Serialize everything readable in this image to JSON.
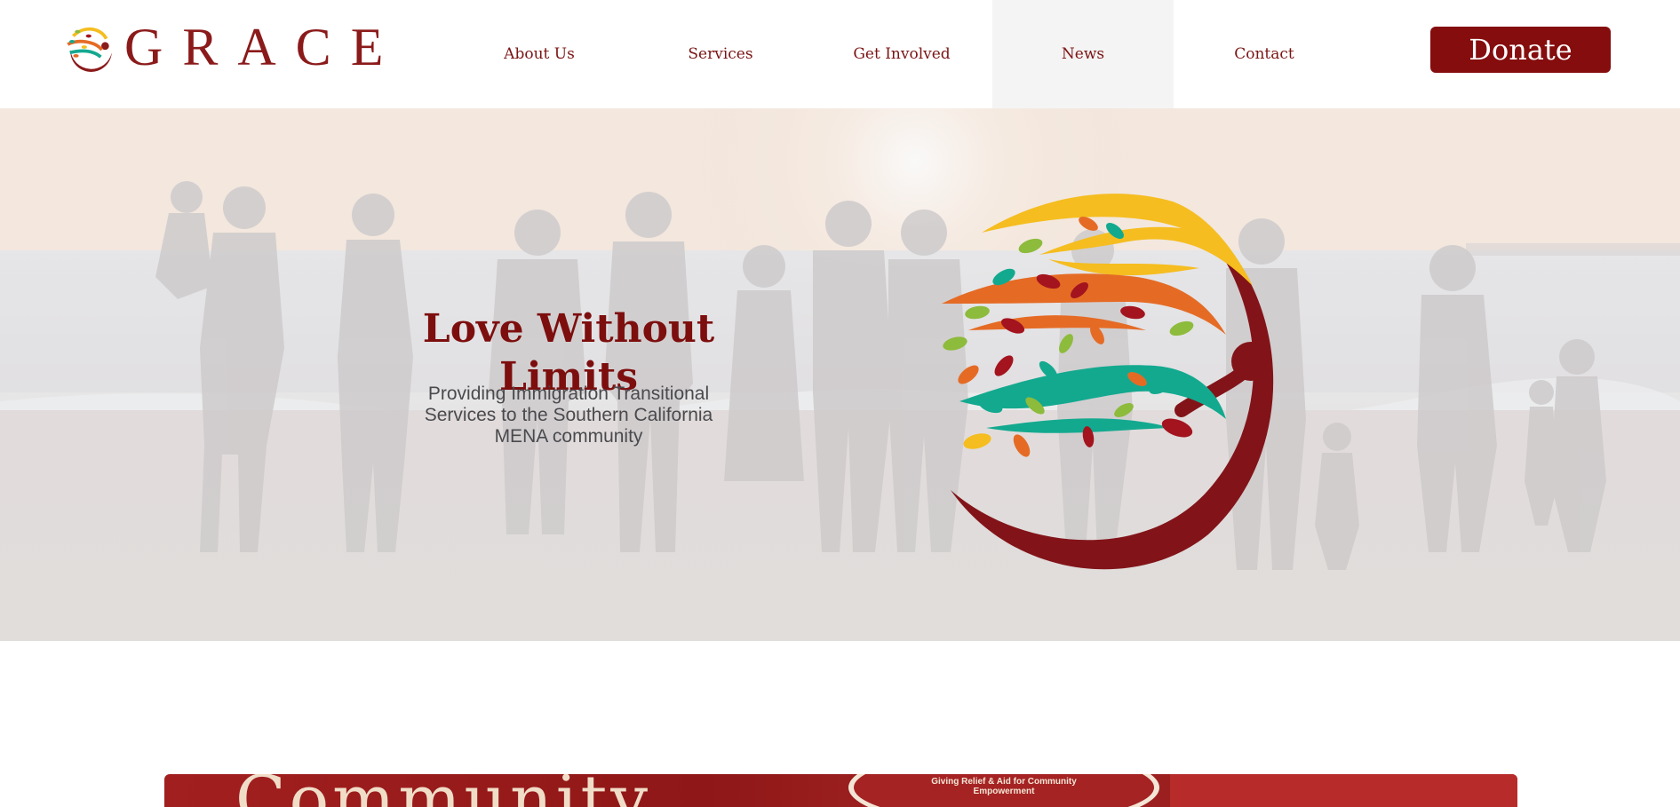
{
  "brand": {
    "name": "GRACE"
  },
  "nav": {
    "items": [
      {
        "label": "About Us"
      },
      {
        "label": "Services"
      },
      {
        "label": "Get Involved"
      },
      {
        "label": "News",
        "active": true
      },
      {
        "label": "Contact"
      }
    ],
    "donate_label": "Donate"
  },
  "hero": {
    "title": "Love Without Limits",
    "subtitle": "Providing Immigration Transitional Services to the Southern California MENA community"
  },
  "feature": {
    "banner_text": "Community",
    "badge_text": "Giving Relief & Aid for Community Empowerment"
  },
  "colors": {
    "brand_red": "#850d0d",
    "nav_text": "#7b1414",
    "logo_yellow": "#f5bd1f",
    "logo_orange": "#e56b25",
    "logo_teal": "#13a98f",
    "logo_green": "#8dbb3c",
    "logo_crimson": "#a3141e"
  },
  "icons": {
    "logo": "tree-person-logo-icon"
  }
}
